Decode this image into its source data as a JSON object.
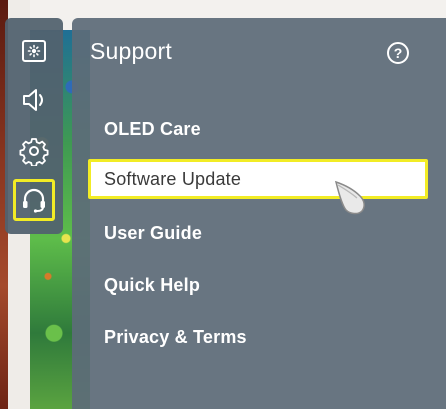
{
  "panel": {
    "title": "Support",
    "help_icon": "question-circle-icon"
  },
  "rail": {
    "items": [
      {
        "name": "picture-settings-icon",
        "selected": false
      },
      {
        "name": "sound-speaker-icon",
        "selected": false
      },
      {
        "name": "gear-icon",
        "selected": false
      },
      {
        "name": "headset-support-icon",
        "selected": true
      }
    ]
  },
  "menu": {
    "items": [
      {
        "label": "OLED Care",
        "focused": false
      },
      {
        "label": "Software Update",
        "focused": true
      },
      {
        "label": "User Guide",
        "focused": false
      },
      {
        "label": "Quick Help",
        "focused": false
      },
      {
        "label": "Privacy & Terms",
        "focused": false
      }
    ]
  },
  "colors": {
    "focus_outline": "#f2ec25",
    "panel_bg": "#5c6c78",
    "text": "#ffffff"
  }
}
